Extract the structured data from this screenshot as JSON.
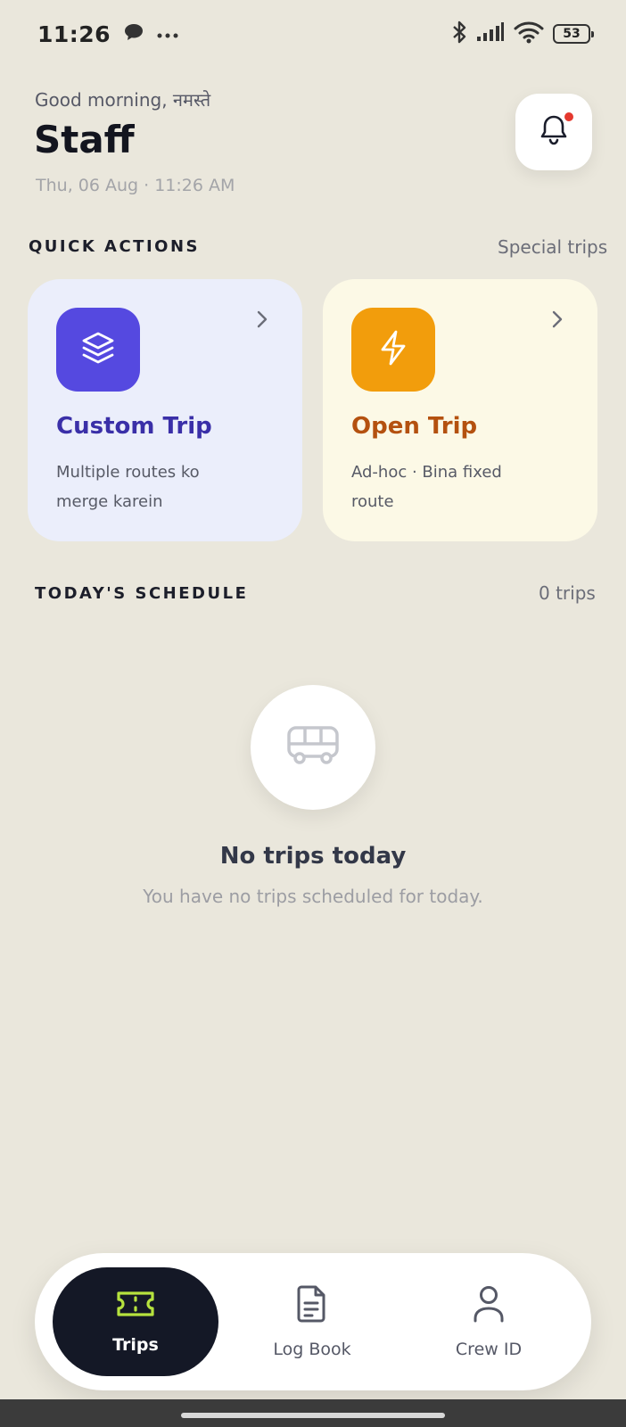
{
  "status_bar": {
    "time": "11:26",
    "battery": "53"
  },
  "header": {
    "greeting": "Good morning, नमस्ते",
    "name": "Staff",
    "datetime": "Thu, 06 Aug  ·  11:26 AM",
    "notification_dot": true
  },
  "quick_actions": {
    "title": "QUICK ACTIONS",
    "link": "Special trips",
    "cards": [
      {
        "title": "Custom Trip",
        "desc": "Multiple routes ko merge karein",
        "icon": "layers-icon",
        "color": "#5549E0"
      },
      {
        "title": "Open Trip",
        "desc": "Ad-hoc · Bina fixed route",
        "icon": "lightning-icon",
        "color": "#F29D0C"
      }
    ]
  },
  "schedule": {
    "title": "TODAY'S SCHEDULE",
    "count": "0 trips",
    "empty_title": "No trips today",
    "empty_sub": "You have no trips scheduled for today."
  },
  "nav": {
    "items": [
      {
        "label": "Trips",
        "icon": "ticket-icon",
        "active": true
      },
      {
        "label": "Log Book",
        "icon": "document-icon",
        "active": false
      },
      {
        "label": "Crew ID",
        "icon": "person-icon",
        "active": false
      }
    ]
  },
  "colors": {
    "background": "#EAE7DC",
    "accent_purple": "#5549E0",
    "accent_orange": "#F29D0C",
    "nav_active": "#141826",
    "ticket_active": "#B6E23E"
  }
}
